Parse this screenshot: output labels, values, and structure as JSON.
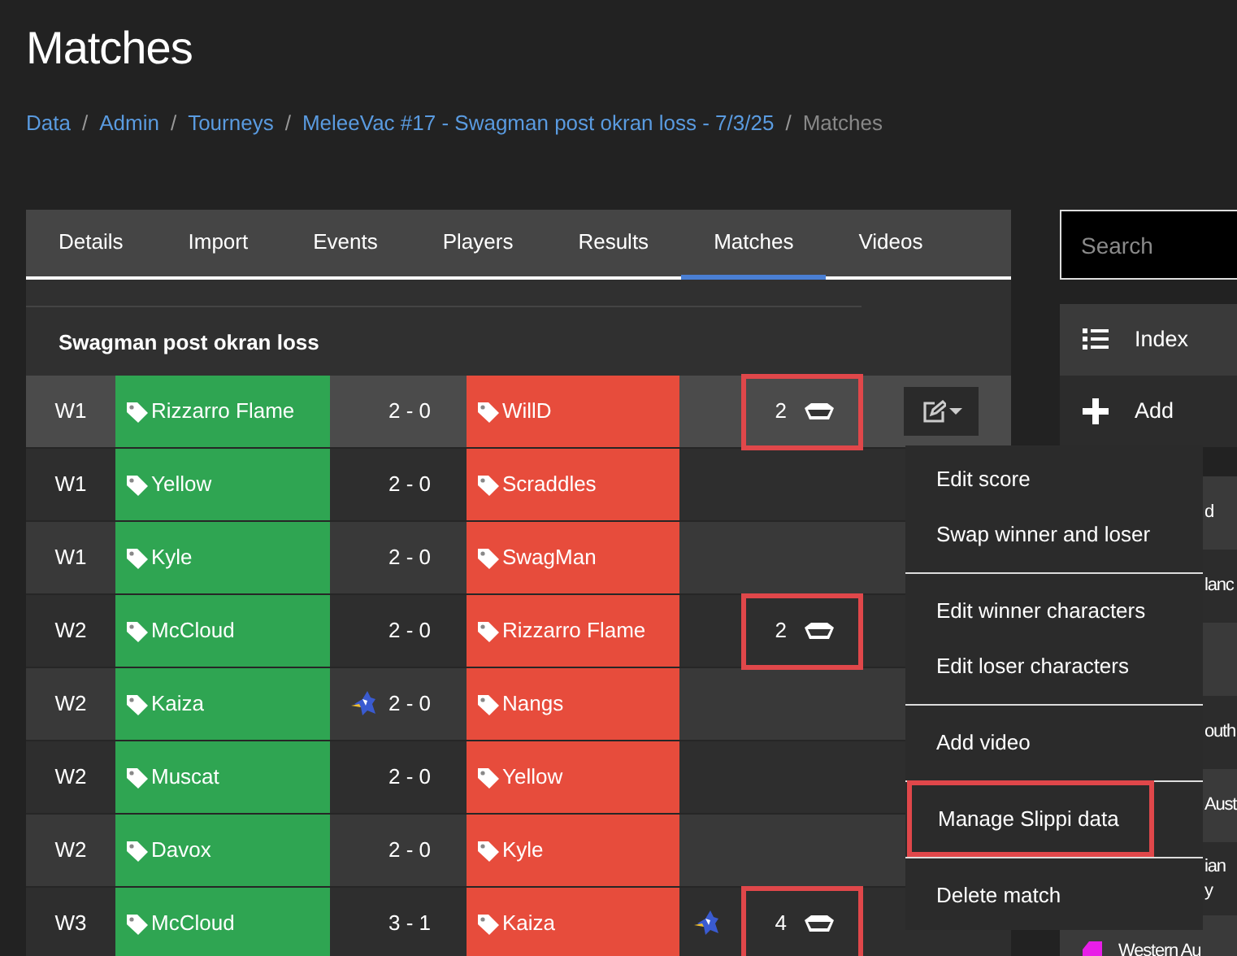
{
  "title": "Matches",
  "breadcrumb": [
    {
      "label": "Data",
      "link": true
    },
    {
      "separator": "/",
      "label": "Admin",
      "link": true
    },
    {
      "separator": "/",
      "label": "Tourneys",
      "link": true
    },
    {
      "separator": "/",
      "label": "MeleeVac #17 - Swagman post okran loss - 7/3/25",
      "link": true
    },
    {
      "separator": "/",
      "label": "Matches",
      "link": false
    }
  ],
  "tabs": [
    {
      "label": "Details",
      "selected": false
    },
    {
      "label": "Import",
      "selected": false
    },
    {
      "label": "Events",
      "selected": false
    },
    {
      "label": "Players",
      "selected": false
    },
    {
      "label": "Results",
      "selected": false
    },
    {
      "label": "Matches",
      "selected": true
    },
    {
      "label": "Videos",
      "selected": false
    }
  ],
  "event_title": "Swagman post okran loss",
  "rows": [
    {
      "round": "W1",
      "winner": "Rizzarro Flame",
      "score": "2 - 0",
      "loser": "WillD",
      "winner_character": false,
      "loser_character": false,
      "slippi_count": "2",
      "slippi_highlighted": true,
      "hovered": true,
      "edit_button": true
    },
    {
      "round": "W1",
      "winner": "Yellow",
      "score": "2 - 0",
      "loser": "Scraddles",
      "winner_character": false,
      "loser_character": false,
      "hovered": false,
      "edit_button": false
    },
    {
      "round": "W1",
      "winner": "Kyle",
      "score": "2 - 0",
      "loser": "SwagMan",
      "winner_character": false,
      "loser_character": false,
      "hovered": false,
      "edit_button": false
    },
    {
      "round": "W2",
      "winner": "McCloud",
      "score": "2 - 0",
      "loser": "Rizzarro Flame",
      "winner_character": false,
      "loser_character": false,
      "slippi_count": "2",
      "slippi_highlighted": true,
      "hovered": false,
      "edit_button": false
    },
    {
      "round": "W2",
      "winner": "Kaiza",
      "score": "2 - 0",
      "loser": "Nangs",
      "winner_character": true,
      "loser_character": false,
      "hovered": false,
      "edit_button": false
    },
    {
      "round": "W2",
      "winner": "Muscat",
      "score": "2 - 0",
      "loser": "Yellow",
      "winner_character": false,
      "loser_character": false,
      "hovered": false,
      "edit_button": false
    },
    {
      "round": "W2",
      "winner": "Davox",
      "score": "2 - 0",
      "loser": "Kyle",
      "winner_character": false,
      "loser_character": false,
      "hovered": false,
      "edit_button": false
    },
    {
      "round": "W3",
      "winner": "McCloud",
      "score": "3 - 1",
      "loser": "Kaiza",
      "winner_character": false,
      "loser_character": true,
      "slippi_count": "4",
      "slippi_highlighted": true,
      "hovered": false,
      "edit_button": false
    }
  ],
  "row_menu": [
    [
      {
        "label": "Edit score",
        "highlighted": false
      },
      {
        "label": "Swap winner and loser",
        "highlighted": false
      }
    ],
    [
      {
        "label": "Edit winner characters",
        "highlighted": false
      },
      {
        "label": "Edit loser characters",
        "highlighted": false
      }
    ],
    [
      {
        "label": "Add video",
        "highlighted": false
      }
    ],
    [
      {
        "label": "Manage Slippi data",
        "highlighted": true
      }
    ],
    [
      {
        "label": "Delete match",
        "highlighted": false
      }
    ]
  ],
  "sidebar": {
    "search": {
      "placeholder": "Search"
    },
    "nav": [
      {
        "label": "Index",
        "kind": "list"
      },
      {
        "label": "Add",
        "kind": "plus"
      }
    ],
    "items": [
      {
        "kind": "text",
        "lines": [
          "d"
        ]
      },
      {
        "kind": "text",
        "lines": [
          "lanc"
        ]
      },
      {
        "kind": "blank"
      },
      {
        "kind": "text",
        "lines": [
          "outh"
        ]
      },
      {
        "kind": "text",
        "lines": [
          "Aust"
        ]
      },
      {
        "kind": "text",
        "lines": [
          "ian",
          "y"
        ]
      },
      {
        "kind": "text",
        "lines": [
          "Western Au"
        ],
        "color": "#e81ee8"
      }
    ]
  }
}
